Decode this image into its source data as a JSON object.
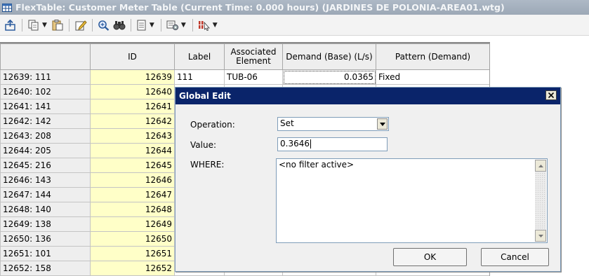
{
  "window": {
    "title": "FlexTable: Customer Meter Table (Current Time: 0.000 hours) (JARDINES DE POLONIA-AREA01.wtg)"
  },
  "toolbar": {
    "buttons": [
      "export-icon",
      "copy-icon",
      "paste-icon",
      "edit-icon",
      "zoom-icon",
      "find-icon",
      "report-icon",
      "options-icon",
      "filter-icon"
    ]
  },
  "table": {
    "headers": {
      "rowhead": "",
      "id": "ID",
      "label": "Label",
      "associated": "Associated Element",
      "demand": "Demand (Base) (L/s)",
      "pattern": "Pattern (Demand)"
    },
    "rows": [
      {
        "rowhead": "12639: 111",
        "id": "12639",
        "label": "111",
        "associated": "TUB-06",
        "demand": "0.0365",
        "pattern": "Fixed"
      },
      {
        "rowhead": "12640: 102",
        "id": "12640",
        "label": "",
        "associated": "",
        "demand": "",
        "pattern": ""
      },
      {
        "rowhead": "12641: 141",
        "id": "12641",
        "label": "",
        "associated": "",
        "demand": "",
        "pattern": ""
      },
      {
        "rowhead": "12642: 142",
        "id": "12642",
        "label": "",
        "associated": "",
        "demand": "",
        "pattern": ""
      },
      {
        "rowhead": "12643: 208",
        "id": "12643",
        "label": "",
        "associated": "",
        "demand": "",
        "pattern": ""
      },
      {
        "rowhead": "12644: 205",
        "id": "12644",
        "label": "",
        "associated": "",
        "demand": "",
        "pattern": ""
      },
      {
        "rowhead": "12645: 216",
        "id": "12645",
        "label": "",
        "associated": "",
        "demand": "",
        "pattern": ""
      },
      {
        "rowhead": "12646: 143",
        "id": "12646",
        "label": "",
        "associated": "",
        "demand": "",
        "pattern": ""
      },
      {
        "rowhead": "12647: 144",
        "id": "12647",
        "label": "",
        "associated": "",
        "demand": "",
        "pattern": ""
      },
      {
        "rowhead": "12648: 140",
        "id": "12648",
        "label": "",
        "associated": "",
        "demand": "",
        "pattern": ""
      },
      {
        "rowhead": "12649: 138",
        "id": "12649",
        "label": "",
        "associated": "",
        "demand": "",
        "pattern": ""
      },
      {
        "rowhead": "12650: 136",
        "id": "12650",
        "label": "",
        "associated": "",
        "demand": "",
        "pattern": ""
      },
      {
        "rowhead": "12651: 101",
        "id": "12651",
        "label": "",
        "associated": "",
        "demand": "",
        "pattern": ""
      },
      {
        "rowhead": "12652: 158",
        "id": "12652",
        "label": "",
        "associated": "",
        "demand": "",
        "pattern": ""
      }
    ]
  },
  "dialog": {
    "title": "Global Edit",
    "operation_label": "Operation:",
    "operation_value": "Set",
    "value_label": "Value:",
    "value_value": "0.3646",
    "where_label": "WHERE:",
    "where_text": "<no filter active>",
    "ok_label": "OK",
    "cancel_label": "Cancel"
  },
  "colors": {
    "title_bar": "#9ca8b6",
    "dialog_title": "#0a246a",
    "id_column": "#ffffc8"
  }
}
